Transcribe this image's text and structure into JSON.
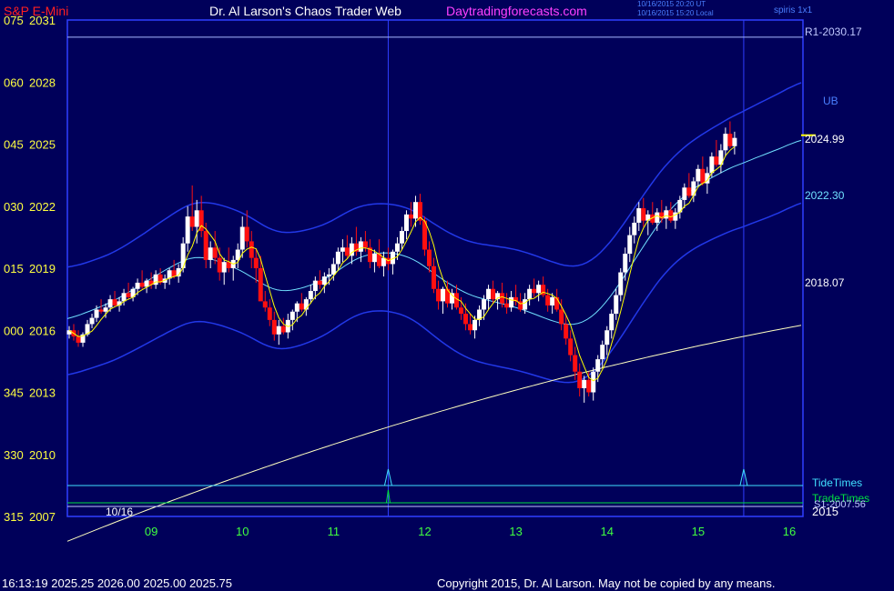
{
  "header": {
    "symbol": "S&P E-Mini",
    "title": "Dr. Al Larson's Chaos Trader Web",
    "site": "Daytradingforecasts.com",
    "stamp_ut": "10/16/2015 20:20 UT",
    "stamp_local": "10/16/2015 15:20 Local",
    "top_right": "spiris 1x1"
  },
  "footer": {
    "quote": "16:13:19  2025.25  2026.00  2025.00  2025.75",
    "copyright": "Copyright 2015, Dr. Al Larson. May not be copied by any means."
  },
  "colors": {
    "background": "#00005a",
    "frame": "#2f3fff",
    "up_candle": "#ffffff",
    "down_candle": "#ff1010",
    "fast_ma": "#ffff00",
    "mid_band": "#70e0ff",
    "long_ma": "#ffffc0",
    "outer_bands": "#2238e8",
    "tide_times": "#40e0ff",
    "trade_times": "#00e040",
    "y_labels": "#ffff40",
    "x_labels": "#40ff40"
  },
  "chart_data": {
    "type": "candlestick",
    "title": "S&P E-Mini",
    "y_ticks": [
      {
        "left": "075",
        "price": "2031"
      },
      {
        "left": "060",
        "price": "2028"
      },
      {
        "left": "045",
        "price": "2025"
      },
      {
        "left": "030",
        "price": "2022"
      },
      {
        "left": "015",
        "price": "2019"
      },
      {
        "left": "000",
        "price": "2016"
      },
      {
        "left": "345",
        "price": "2013"
      },
      {
        "left": "330",
        "price": "2010"
      },
      {
        "left": "315",
        "price": "2007"
      }
    ],
    "y_range": [
      2007,
      2031
    ],
    "x_ticks": [
      "09",
      "10",
      "11",
      "12",
      "13",
      "14",
      "15",
      "16"
    ],
    "date_label": "10/16",
    "year_label": "2015",
    "levels": [
      {
        "name": "R1-2030.17",
        "value": 2030.17
      },
      {
        "name": "UB",
        "value": null
      },
      {
        "name": "2024.99",
        "value": 2024.99
      },
      {
        "name": "2022.30",
        "value": 2022.3
      },
      {
        "name": "2018.07",
        "value": 2018.07
      }
    ],
    "timing_lines": [
      "TideTimes",
      "TradeTimes",
      "S1-2007.56"
    ],
    "timing_spikes_hours": [
      11.6,
      15.5
    ],
    "series_overlays": [
      "fast moving average",
      "middle band",
      "upper band",
      "lower band",
      "long moving average"
    ],
    "candles": [
      [
        8.1,
        2015.8,
        2016.2,
        2015.6,
        2016.0
      ],
      [
        8.15,
        2016.0,
        2016.3,
        2015.5,
        2015.7
      ],
      [
        8.2,
        2015.7,
        2016.0,
        2015.2,
        2015.4
      ],
      [
        8.25,
        2015.4,
        2015.9,
        2015.2,
        2015.8
      ],
      [
        8.3,
        2015.8,
        2016.5,
        2015.7,
        2016.3
      ],
      [
        8.35,
        2016.3,
        2016.8,
        2016.1,
        2016.6
      ],
      [
        8.4,
        2016.6,
        2017.2,
        2016.4,
        2017.0
      ],
      [
        8.45,
        2017.0,
        2017.5,
        2016.8,
        2016.9
      ],
      [
        8.5,
        2016.9,
        2017.3,
        2016.6,
        2017.1
      ],
      [
        8.55,
        2017.1,
        2017.7,
        2016.9,
        2017.5
      ],
      [
        8.6,
        2017.5,
        2017.9,
        2017.1,
        2017.2
      ],
      [
        8.65,
        2017.2,
        2017.6,
        2016.9,
        2017.4
      ],
      [
        8.7,
        2017.4,
        2018.0,
        2017.2,
        2017.8
      ],
      [
        8.75,
        2017.8,
        2018.3,
        2017.5,
        2017.6
      ],
      [
        8.8,
        2017.6,
        2018.1,
        2017.4,
        2018.0
      ],
      [
        8.85,
        2018.0,
        2018.5,
        2017.7,
        2018.3
      ],
      [
        8.9,
        2018.3,
        2018.9,
        2018.0,
        2018.1
      ],
      [
        8.95,
        2018.1,
        2018.5,
        2017.8,
        2018.4
      ],
      [
        9.0,
        2018.4,
        2018.8,
        2018.0,
        2018.2
      ],
      [
        9.05,
        2018.2,
        2018.9,
        2018.0,
        2018.7
      ],
      [
        9.1,
        2018.7,
        2019.0,
        2018.2,
        2018.3
      ],
      [
        9.15,
        2018.3,
        2018.7,
        2018.0,
        2018.5
      ],
      [
        9.2,
        2018.5,
        2019.0,
        2018.2,
        2018.9
      ],
      [
        9.25,
        2018.9,
        2019.4,
        2018.5,
        2018.6
      ],
      [
        9.3,
        2018.6,
        2019.2,
        2018.3,
        2019.0
      ],
      [
        9.35,
        2019.0,
        2020.5,
        2018.8,
        2020.2
      ],
      [
        9.4,
        2020.2,
        2022.0,
        2019.8,
        2021.5
      ],
      [
        9.45,
        2021.5,
        2023.0,
        2020.8,
        2021.0
      ],
      [
        9.5,
        2021.0,
        2022.3,
        2020.2,
        2021.8
      ],
      [
        9.55,
        2021.8,
        2022.5,
        2020.5,
        2020.8
      ],
      [
        9.6,
        2020.8,
        2021.2,
        2019.0,
        2019.4
      ],
      [
        9.65,
        2019.4,
        2020.3,
        2019.0,
        2020.0
      ],
      [
        9.7,
        2020.0,
        2020.8,
        2019.2,
        2019.5
      ],
      [
        9.75,
        2019.5,
        2020.0,
        2018.4,
        2018.8
      ],
      [
        9.8,
        2018.8,
        2019.5,
        2018.2,
        2019.3
      ],
      [
        9.85,
        2019.3,
        2020.0,
        2018.8,
        2019.0
      ],
      [
        9.9,
        2019.0,
        2019.6,
        2018.4,
        2019.4
      ],
      [
        9.95,
        2019.4,
        2020.2,
        2019.0,
        2019.9
      ],
      [
        10.0,
        2019.9,
        2021.5,
        2019.5,
        2021.0
      ],
      [
        10.05,
        2021.0,
        2021.8,
        2020.0,
        2020.3
      ],
      [
        10.1,
        2020.3,
        2020.8,
        2019.0,
        2019.5
      ],
      [
        10.15,
        2019.5,
        2019.9,
        2018.3,
        2019.0
      ],
      [
        10.2,
        2019.0,
        2019.6,
        2017.8,
        2017.4
      ],
      [
        10.25,
        2017.4,
        2017.9,
        2016.9,
        2017.1
      ],
      [
        10.3,
        2017.1,
        2017.5,
        2016.2,
        2016.5
      ],
      [
        10.35,
        2016.5,
        2016.9,
        2015.5,
        2015.8
      ],
      [
        10.4,
        2015.8,
        2016.5,
        2015.3,
        2016.2
      ],
      [
        10.45,
        2016.2,
        2016.6,
        2015.8,
        2015.9
      ],
      [
        10.5,
        2015.9,
        2016.8,
        2015.6,
        2016.5
      ],
      [
        10.55,
        2016.5,
        2017.0,
        2016.0,
        2016.9
      ],
      [
        10.6,
        2016.9,
        2017.4,
        2016.4,
        2017.3
      ],
      [
        10.65,
        2017.3,
        2017.8,
        2016.9,
        2017.0
      ],
      [
        10.7,
        2017.0,
        2017.6,
        2016.7,
        2017.5
      ],
      [
        10.75,
        2017.5,
        2018.2,
        2017.3,
        2017.9
      ],
      [
        10.8,
        2017.9,
        2018.6,
        2017.5,
        2018.4
      ],
      [
        10.85,
        2018.4,
        2018.9,
        2018.0,
        2018.2
      ],
      [
        10.9,
        2018.2,
        2018.8,
        2017.8,
        2018.6
      ],
      [
        10.95,
        2018.6,
        2019.0,
        2018.2,
        2018.7
      ],
      [
        11.0,
        2018.7,
        2019.5,
        2018.4,
        2019.2
      ],
      [
        11.05,
        2019.2,
        2020.0,
        2018.9,
        2019.8
      ],
      [
        11.1,
        2019.8,
        2020.4,
        2019.3,
        2020.0
      ],
      [
        11.15,
        2020.0,
        2020.6,
        2019.5,
        2019.6
      ],
      [
        11.2,
        2019.6,
        2020.5,
        2019.2,
        2020.2
      ],
      [
        11.25,
        2020.2,
        2021.0,
        2019.6,
        2019.8
      ],
      [
        11.3,
        2019.8,
        2020.5,
        2019.3,
        2020.3
      ],
      [
        11.35,
        2020.3,
        2020.8,
        2019.8,
        2020.0
      ],
      [
        11.4,
        2020.0,
        2020.4,
        2019.0,
        2019.3
      ],
      [
        11.45,
        2019.3,
        2019.9,
        2018.8,
        2019.7
      ],
      [
        11.5,
        2019.7,
        2020.4,
        2019.0,
        2019.1
      ],
      [
        11.55,
        2019.1,
        2019.8,
        2018.6,
        2019.5
      ],
      [
        11.6,
        2019.5,
        2020.0,
        2018.9,
        2019.2
      ],
      [
        11.65,
        2019.2,
        2019.9,
        2018.7,
        2019.8
      ],
      [
        11.7,
        2019.8,
        2020.5,
        2019.4,
        2020.2
      ],
      [
        11.75,
        2020.2,
        2021.0,
        2019.9,
        2020.8
      ],
      [
        11.8,
        2020.8,
        2021.8,
        2020.4,
        2021.6
      ],
      [
        11.85,
        2021.6,
        2022.2,
        2021.0,
        2021.4
      ],
      [
        11.9,
        2021.4,
        2022.5,
        2021.0,
        2022.2
      ],
      [
        11.95,
        2022.2,
        2022.6,
        2021.1,
        2021.3
      ],
      [
        12.0,
        2021.3,
        2021.5,
        2019.6,
        2019.9
      ],
      [
        12.05,
        2019.9,
        2020.3,
        2018.8,
        2019.1
      ],
      [
        12.1,
        2019.1,
        2019.5,
        2017.8,
        2018.0
      ],
      [
        12.15,
        2018.0,
        2018.4,
        2017.0,
        2017.4
      ],
      [
        12.2,
        2017.4,
        2018.1,
        2016.8,
        2018.0
      ],
      [
        12.25,
        2018.0,
        2018.4,
        2017.1,
        2017.3
      ],
      [
        12.3,
        2017.3,
        2018.0,
        2017.0,
        2017.8
      ],
      [
        12.35,
        2017.8,
        2018.2,
        2017.0,
        2017.1
      ],
      [
        12.4,
        2017.1,
        2017.6,
        2016.5,
        2016.8
      ],
      [
        12.45,
        2016.8,
        2017.3,
        2016.0,
        2016.3
      ],
      [
        12.5,
        2016.3,
        2016.8,
        2015.8,
        2016.0
      ],
      [
        12.55,
        2016.0,
        2016.7,
        2015.6,
        2016.5
      ],
      [
        12.6,
        2016.5,
        2017.2,
        2016.2,
        2017.0
      ],
      [
        12.65,
        2017.0,
        2017.7,
        2016.5,
        2017.5
      ],
      [
        12.7,
        2017.5,
        2018.2,
        2017.0,
        2018.0
      ],
      [
        12.75,
        2018.0,
        2018.4,
        2017.3,
        2017.5
      ],
      [
        12.8,
        2017.5,
        2017.9,
        2017.0,
        2017.8
      ],
      [
        12.85,
        2017.8,
        2018.3,
        2017.1,
        2017.3
      ],
      [
        12.9,
        2017.3,
        2017.8,
        2016.8,
        2017.1
      ],
      [
        12.95,
        2017.1,
        2017.9,
        2016.9,
        2017.6
      ],
      [
        13.0,
        2017.6,
        2018.2,
        2017.2,
        2017.4
      ],
      [
        13.05,
        2017.4,
        2017.8,
        2016.9,
        2017.0
      ],
      [
        13.1,
        2017.0,
        2017.8,
        2016.8,
        2017.5
      ],
      [
        13.15,
        2017.5,
        2018.2,
        2017.2,
        2018.0
      ],
      [
        13.2,
        2018.0,
        2018.5,
        2017.6,
        2017.8
      ],
      [
        13.25,
        2017.8,
        2018.4,
        2017.4,
        2018.2
      ],
      [
        13.3,
        2018.2,
        2018.6,
        2017.6,
        2017.7
      ],
      [
        13.35,
        2017.7,
        2018.0,
        2016.9,
        2017.2
      ],
      [
        13.4,
        2017.2,
        2017.8,
        2016.8,
        2017.6
      ],
      [
        13.45,
        2017.6,
        2018.0,
        2016.9,
        2017.0
      ],
      [
        13.5,
        2017.0,
        2017.5,
        2016.0,
        2016.3
      ],
      [
        13.55,
        2016.3,
        2016.7,
        2015.3,
        2015.6
      ],
      [
        13.6,
        2015.6,
        2016.0,
        2014.5,
        2014.8
      ],
      [
        13.65,
        2014.8,
        2015.2,
        2013.6,
        2014.0
      ],
      [
        13.7,
        2014.0,
        2014.4,
        2012.8,
        2013.2
      ],
      [
        13.75,
        2013.2,
        2013.8,
        2012.5,
        2013.6
      ],
      [
        13.8,
        2013.6,
        2014.0,
        2012.8,
        2013.0
      ],
      [
        13.85,
        2013.0,
        2014.2,
        2012.6,
        2014.0
      ],
      [
        13.9,
        2014.0,
        2014.8,
        2013.5,
        2014.6
      ],
      [
        13.95,
        2014.6,
        2015.5,
        2014.2,
        2015.3
      ],
      [
        14.0,
        2015.3,
        2016.2,
        2014.8,
        2016.0
      ],
      [
        14.05,
        2016.0,
        2017.0,
        2015.6,
        2016.8
      ],
      [
        14.1,
        2016.8,
        2018.0,
        2016.5,
        2017.7
      ],
      [
        14.15,
        2017.7,
        2019.0,
        2017.4,
        2018.8
      ],
      [
        14.2,
        2018.8,
        2020.0,
        2018.4,
        2019.7
      ],
      [
        14.25,
        2019.7,
        2021.0,
        2019.3,
        2020.6
      ],
      [
        14.3,
        2020.6,
        2021.5,
        2020.2,
        2021.2
      ],
      [
        14.35,
        2021.2,
        2022.2,
        2020.8,
        2021.9
      ],
      [
        14.4,
        2021.9,
        2022.4,
        2021.0,
        2021.3
      ],
      [
        14.45,
        2021.3,
        2021.8,
        2020.6,
        2021.6
      ],
      [
        14.5,
        2021.6,
        2022.2,
        2021.1,
        2021.2
      ],
      [
        14.55,
        2021.2,
        2021.9,
        2020.8,
        2021.7
      ],
      [
        14.6,
        2021.7,
        2022.3,
        2021.2,
        2021.4
      ],
      [
        14.65,
        2021.4,
        2022.0,
        2020.9,
        2021.8
      ],
      [
        14.7,
        2021.8,
        2022.2,
        2021.2,
        2021.3
      ],
      [
        14.75,
        2021.3,
        2021.9,
        2020.9,
        2021.7
      ],
      [
        14.8,
        2021.7,
        2022.5,
        2021.4,
        2022.3
      ],
      [
        14.85,
        2022.3,
        2023.1,
        2021.9,
        2022.9
      ],
      [
        14.9,
        2022.9,
        2023.6,
        2022.4,
        2022.5
      ],
      [
        14.95,
        2022.5,
        2023.4,
        2022.2,
        2023.2
      ],
      [
        15.0,
        2023.2,
        2024.0,
        2022.9,
        2023.8
      ],
      [
        15.05,
        2023.8,
        2024.4,
        2023.0,
        2023.1
      ],
      [
        15.1,
        2023.1,
        2023.9,
        2022.6,
        2023.6
      ],
      [
        15.15,
        2023.6,
        2024.6,
        2023.4,
        2024.4
      ],
      [
        15.2,
        2024.4,
        2025.2,
        2023.9,
        2024.0
      ],
      [
        15.25,
        2024.0,
        2025.0,
        2023.6,
        2024.7
      ],
      [
        15.3,
        2024.7,
        2025.8,
        2024.4,
        2025.5
      ],
      [
        15.35,
        2025.5,
        2026.1,
        2024.8,
        2024.9
      ],
      [
        15.4,
        2024.9,
        2025.6,
        2024.5,
        2025.3
      ]
    ]
  }
}
